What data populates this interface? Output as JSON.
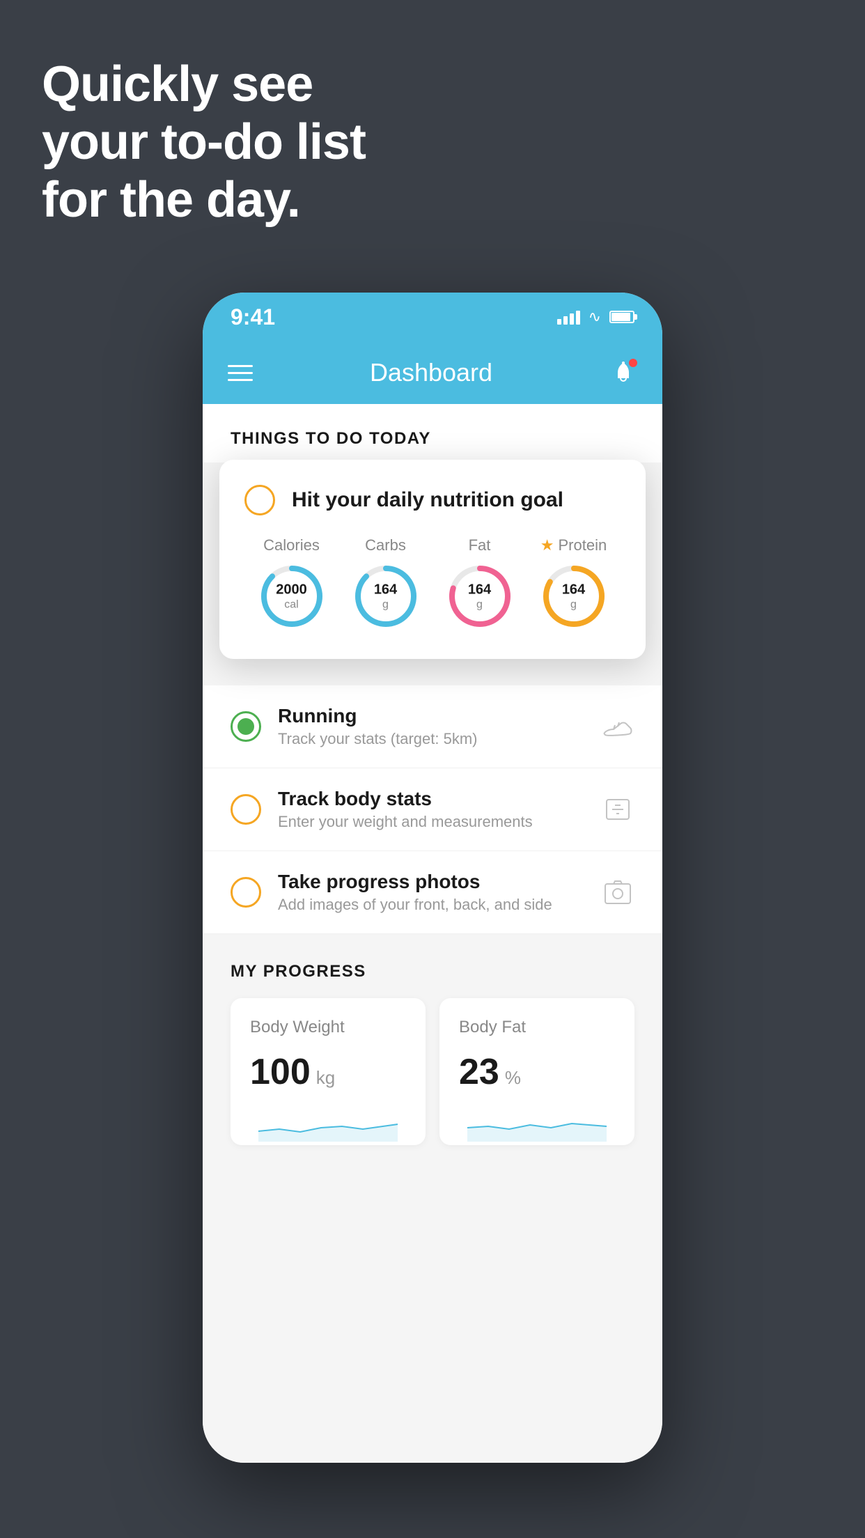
{
  "hero": {
    "line1": "Quickly see",
    "line2": "your to-do list",
    "line3": "for the day."
  },
  "phone": {
    "status_bar": {
      "time": "9:41"
    },
    "nav": {
      "title": "Dashboard"
    },
    "things_header": "THINGS TO DO TODAY",
    "floating_card": {
      "title": "Hit your daily nutrition goal",
      "macros": [
        {
          "label": "Calories",
          "value": "2000",
          "unit": "cal",
          "color": "blue",
          "starred": false
        },
        {
          "label": "Carbs",
          "value": "164",
          "unit": "g",
          "color": "blue",
          "starred": false
        },
        {
          "label": "Fat",
          "value": "164",
          "unit": "g",
          "color": "pink",
          "starred": false
        },
        {
          "label": "Protein",
          "value": "164",
          "unit": "g",
          "color": "gold",
          "starred": true
        }
      ]
    },
    "todo_items": [
      {
        "title": "Running",
        "subtitle": "Track your stats (target: 5km)",
        "status": "active",
        "icon": "shoe"
      },
      {
        "title": "Track body stats",
        "subtitle": "Enter your weight and measurements",
        "status": "pending",
        "icon": "scale"
      },
      {
        "title": "Take progress photos",
        "subtitle": "Add images of your front, back, and side",
        "status": "pending",
        "icon": "photo"
      }
    ],
    "progress": {
      "header": "MY PROGRESS",
      "cards": [
        {
          "title": "Body Weight",
          "value": "100",
          "unit": "kg"
        },
        {
          "title": "Body Fat",
          "value": "23",
          "unit": "%"
        }
      ]
    }
  }
}
